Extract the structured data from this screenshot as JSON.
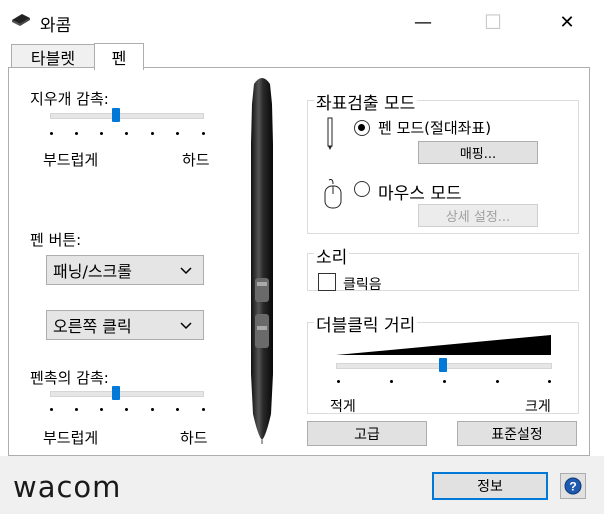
{
  "window": {
    "title": "와콤",
    "minimize_glyph": "—",
    "maximize_glyph": "☐",
    "close_glyph": "✕"
  },
  "tabs": [
    {
      "label": "타블렛",
      "selected": false
    },
    {
      "label": "펜",
      "selected": true
    }
  ],
  "eraser": {
    "label": "지우개 감촉:",
    "soft_label": "부드럽게",
    "hard_label": "하드",
    "level_fraction": 0.43
  },
  "pen_buttons": {
    "label": "펜 버튼:",
    "upper_value": "패닝/스크롤",
    "lower_value": "오른쪽 클릭"
  },
  "tip_feel": {
    "label": "펜촉의 감촉:",
    "soft_label": "부드럽게",
    "hard_label": "하드",
    "level_fraction": 0.43
  },
  "tracking_mode": {
    "title": "좌표검출 모드",
    "pen_mode_label": "펜 모드(절대좌표)",
    "pen_mode_selected": true,
    "mapping_button": "매핑...",
    "mouse_mode_label": "마우스 모드",
    "mouse_mode_selected": false,
    "details_button": "상세 설정..."
  },
  "sound": {
    "title": "소리",
    "click_sound_label": "클릭음",
    "click_sound_checked": false
  },
  "double_click": {
    "title": "더블클릭 거리",
    "small_label": "적게",
    "large_label": "크게",
    "level_fraction": 0.5
  },
  "buttons": {
    "advanced": "고급",
    "defaults": "표준설정",
    "info": "정보"
  },
  "logo_text": "wacom",
  "accent_color": "#0078d7"
}
